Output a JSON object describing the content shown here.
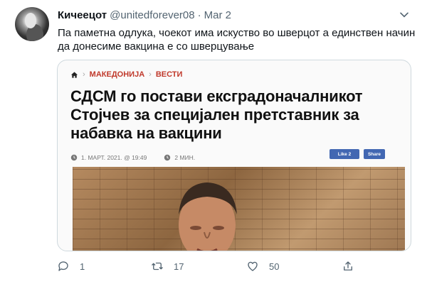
{
  "tweet": {
    "display_name": "Кичеецот",
    "handle": "@unitedforever08",
    "separator": "·",
    "date": "Mar 2",
    "text": "Па паметна одлука, чоекот има искуство во шверцот а единствен начин да донесиме вакцина е со шверцување"
  },
  "article": {
    "breadcrumb": [
      "МАКЕДОНИЈА",
      "ВЕСТИ"
    ],
    "breadcrumb_separator": "›",
    "headline": "СДСМ го постави екс­градоначалникот Стојчев за специјален претставник за набавка на вакцини",
    "date_time": "1. МАРТ. 2021. @ 19:49",
    "read_time": "2 МИН.",
    "like_label": "Like 2",
    "share_label": "Share"
  },
  "actions": {
    "reply_count": "1",
    "retweet_count": "17",
    "like_count": "50",
    "share_count": ""
  },
  "colors": {
    "text_primary": "#0f1419",
    "text_secondary": "#536471",
    "border": "#cfd9de",
    "breadcrumb_red": "#c0392b",
    "facebook_blue": "#4267b2"
  },
  "icons": [
    "more-icon",
    "home-icon",
    "clock-icon",
    "read-time-icon",
    "reply-icon",
    "retweet-icon",
    "like-icon",
    "share-icon"
  ]
}
